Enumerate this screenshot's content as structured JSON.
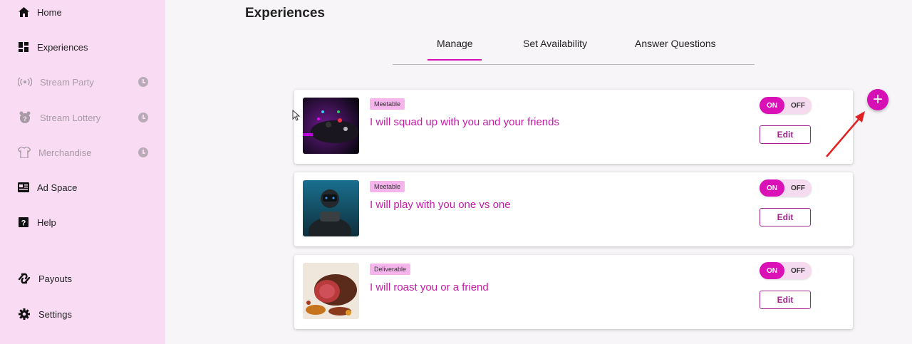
{
  "sidebar": {
    "items": [
      {
        "label": "Home",
        "icon": "home-icon"
      },
      {
        "label": "Experiences",
        "icon": "dashboard-icon"
      },
      {
        "label": "Stream Party",
        "icon": "broadcast-icon",
        "locked": true
      },
      {
        "label": "Stream Lottery",
        "icon": "lottery-icon",
        "locked": true
      },
      {
        "label": "Merchandise",
        "icon": "shirt-icon",
        "locked": true
      },
      {
        "label": "Ad Space",
        "icon": "newspaper-icon"
      },
      {
        "label": "Help",
        "icon": "help-icon"
      },
      {
        "label": "Payouts",
        "icon": "payouts-icon"
      },
      {
        "label": "Settings",
        "icon": "gear-icon"
      }
    ]
  },
  "page": {
    "title": "Experiences",
    "tabs": [
      {
        "label": "Manage",
        "active": true
      },
      {
        "label": "Set Availability"
      },
      {
        "label": "Answer Questions"
      }
    ]
  },
  "experiences": [
    {
      "badge": "Meetable",
      "title": "I will squad up with you and your friends",
      "on_label": "ON",
      "off_label": "OFF",
      "edit_label": "Edit",
      "image": "gaming-controller"
    },
    {
      "badge": "Meetable",
      "title": "I will play with you one vs one",
      "on_label": "ON",
      "off_label": "OFF",
      "edit_label": "Edit",
      "image": "gamer-in-mask"
    },
    {
      "badge": "Deliverable",
      "title": "I will roast you or a friend",
      "on_label": "ON",
      "off_label": "OFF",
      "edit_label": "Edit",
      "image": "roast-beef"
    }
  ],
  "colors": {
    "accent": "#d60fb4",
    "sidebar_bg": "#f9dcf4",
    "title": "#c71aa8"
  },
  "add_button": {
    "symbol": "+"
  }
}
